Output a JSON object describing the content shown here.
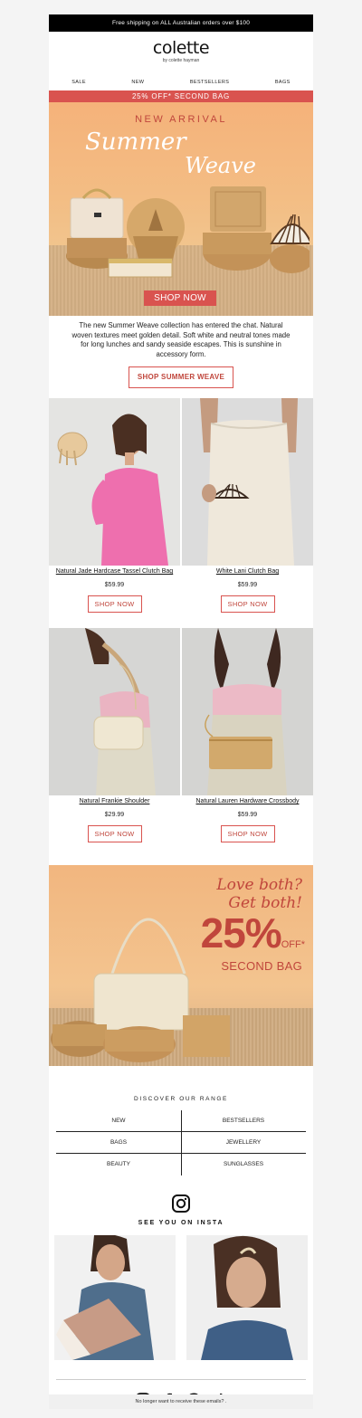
{
  "topbar": {
    "text": "Free shipping on ALL Australian orders over $100"
  },
  "brand": {
    "logo": "colette",
    "sub": "by colette hayman"
  },
  "nav": {
    "items": [
      "SALE",
      "NEW",
      "BESTSELLERS",
      "BAGS"
    ]
  },
  "promo": {
    "text": "25% OFF* SECOND BAG"
  },
  "hero": {
    "kicker": "NEW ARRIVAL",
    "script_line1": "Summer",
    "script_line2": "Weave",
    "button": "SHOP NOW"
  },
  "intro": {
    "text": "The new Summer Weave collection has entered the chat. Natural woven textures meet golden detail. Soft white and neutral tones made for long lunches and sandy seaside escapes. This is sunshine in accessory form.",
    "cta": "SHOP SUMMER WEAVE"
  },
  "products": [
    {
      "name": "Natural Jade Hardcase Tassel Clutch Bag",
      "price": "$59.99",
      "button": "SHOP NOW"
    },
    {
      "name": "White Lani Clutch Bag",
      "price": "$59.99",
      "button": "SHOP NOW"
    },
    {
      "name": "Natural Frankie Shoulder",
      "price": "$29.99",
      "button": "SHOP NOW"
    },
    {
      "name": "Natural Lauren Hardware Crossbody",
      "price": "$59.99",
      "button": "SHOP NOW"
    }
  ],
  "banner2": {
    "line1": "Love both?",
    "line2": "Get both!",
    "percent": "25%",
    "off": "OFF*",
    "second_bag": "SECOND BAG"
  },
  "discover": {
    "title": "DISCOVER OUR RANGE",
    "items": [
      "NEW",
      "BESTSELLERS",
      "BAGS",
      "JEWELLERY",
      "BEAUTY",
      "SUNGLASSES"
    ]
  },
  "insta": {
    "title": "SEE YOU ON INSTA"
  },
  "socials": [
    "instagram-icon",
    "facebook-icon",
    "pinterest-icon",
    "tiktok-icon"
  ],
  "footer": {
    "text": "No longer want to receive these emails? ."
  },
  "colors": {
    "accent": "#d9534f",
    "black": "#000000",
    "peach": "#f3bd84"
  }
}
